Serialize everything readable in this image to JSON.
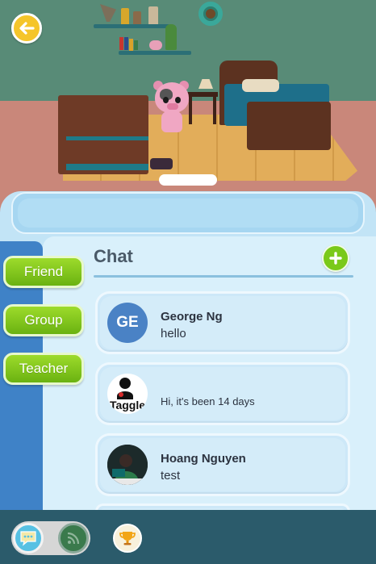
{
  "header": {
    "back_icon": "back-arrow-icon"
  },
  "sidebar": {
    "items": [
      {
        "label": "Friend"
      },
      {
        "label": "Group"
      },
      {
        "label": "Teacher"
      }
    ]
  },
  "chat": {
    "title": "Chat",
    "add_icon": "plus-icon",
    "conversations": [
      {
        "avatar_initials": "GE",
        "name": "George Ng",
        "message": "hello"
      },
      {
        "avatar_text": "Taggle",
        "name": "",
        "message": "Hi, it's been 14 days"
      },
      {
        "name": "Hoang Nguyen",
        "message": "test"
      }
    ]
  },
  "bottom_bar": {
    "icons": [
      "chat-bubble-icon",
      "feed-icon",
      "trophy-icon"
    ]
  },
  "colors": {
    "accent_green": "#7ac919",
    "panel_blue": "#c2e4f6",
    "sidebar_blue": "#3f82c7",
    "back_yellow": "#f5c52a",
    "bottom_bar": "#2b5b6b"
  }
}
